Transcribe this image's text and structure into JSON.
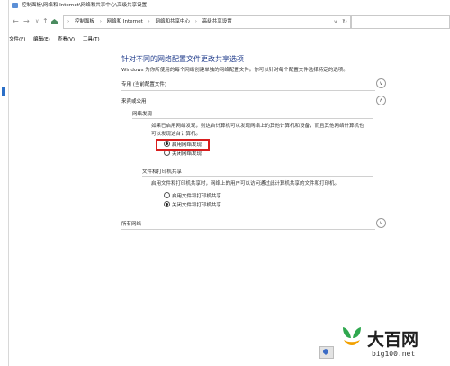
{
  "window": {
    "title": "控制面板\\网络和 Internet\\网络和共享中心\\高级共享设置"
  },
  "nav": {
    "back": "←",
    "forward": "→",
    "up": "↑"
  },
  "address": {
    "breadcrumb": [
      "控制面板",
      "网络和 Internet",
      "网络和共享中心",
      "高级共享设置"
    ],
    "sep": "›",
    "dropdown": "∨",
    "refresh": "↻"
  },
  "menu": {
    "file": "文件(F)",
    "edit": "编辑(E)",
    "view": "查看(V)",
    "tools": "工具(T)"
  },
  "page": {
    "heading": "针对不同的网络配置文件更改共享选项",
    "description": "Windows 为你所使用的每个网络创建单独的网络配置文件。你可以针对每个配置文件选择特定的选项。"
  },
  "profiles": {
    "private": {
      "label": "专用 (当前配置文件)",
      "chevron": "∨"
    },
    "guest": {
      "label": "来宾或公用",
      "chevron": "∧"
    },
    "all": {
      "label": "所有网络",
      "chevron": "∨"
    }
  },
  "discovery": {
    "title": "网络发现",
    "text_line1": "如果已启用网络发现，则这台计算机可以发现网络上的其他计算机和设备，而且其他网络计算机也",
    "text_line2": "可以发现这台计算机。",
    "option_on": "启用网络发现",
    "option_off": "关闭网络发现",
    "selected": "on"
  },
  "sharing": {
    "title": "文件和打印机共享",
    "text": "启用文件和打印机共享时，网络上的用户可以访问通过此计算机共享的文件和打印机。",
    "option_on": "启用文件和打印机共享",
    "option_off": "关闭文件和打印机共享",
    "selected": "off"
  },
  "watermark": {
    "name": "大百网",
    "site": "big100.net"
  },
  "icons": {
    "home": "home-icon",
    "shield": "shield-icon",
    "logo": "big100-logo"
  }
}
